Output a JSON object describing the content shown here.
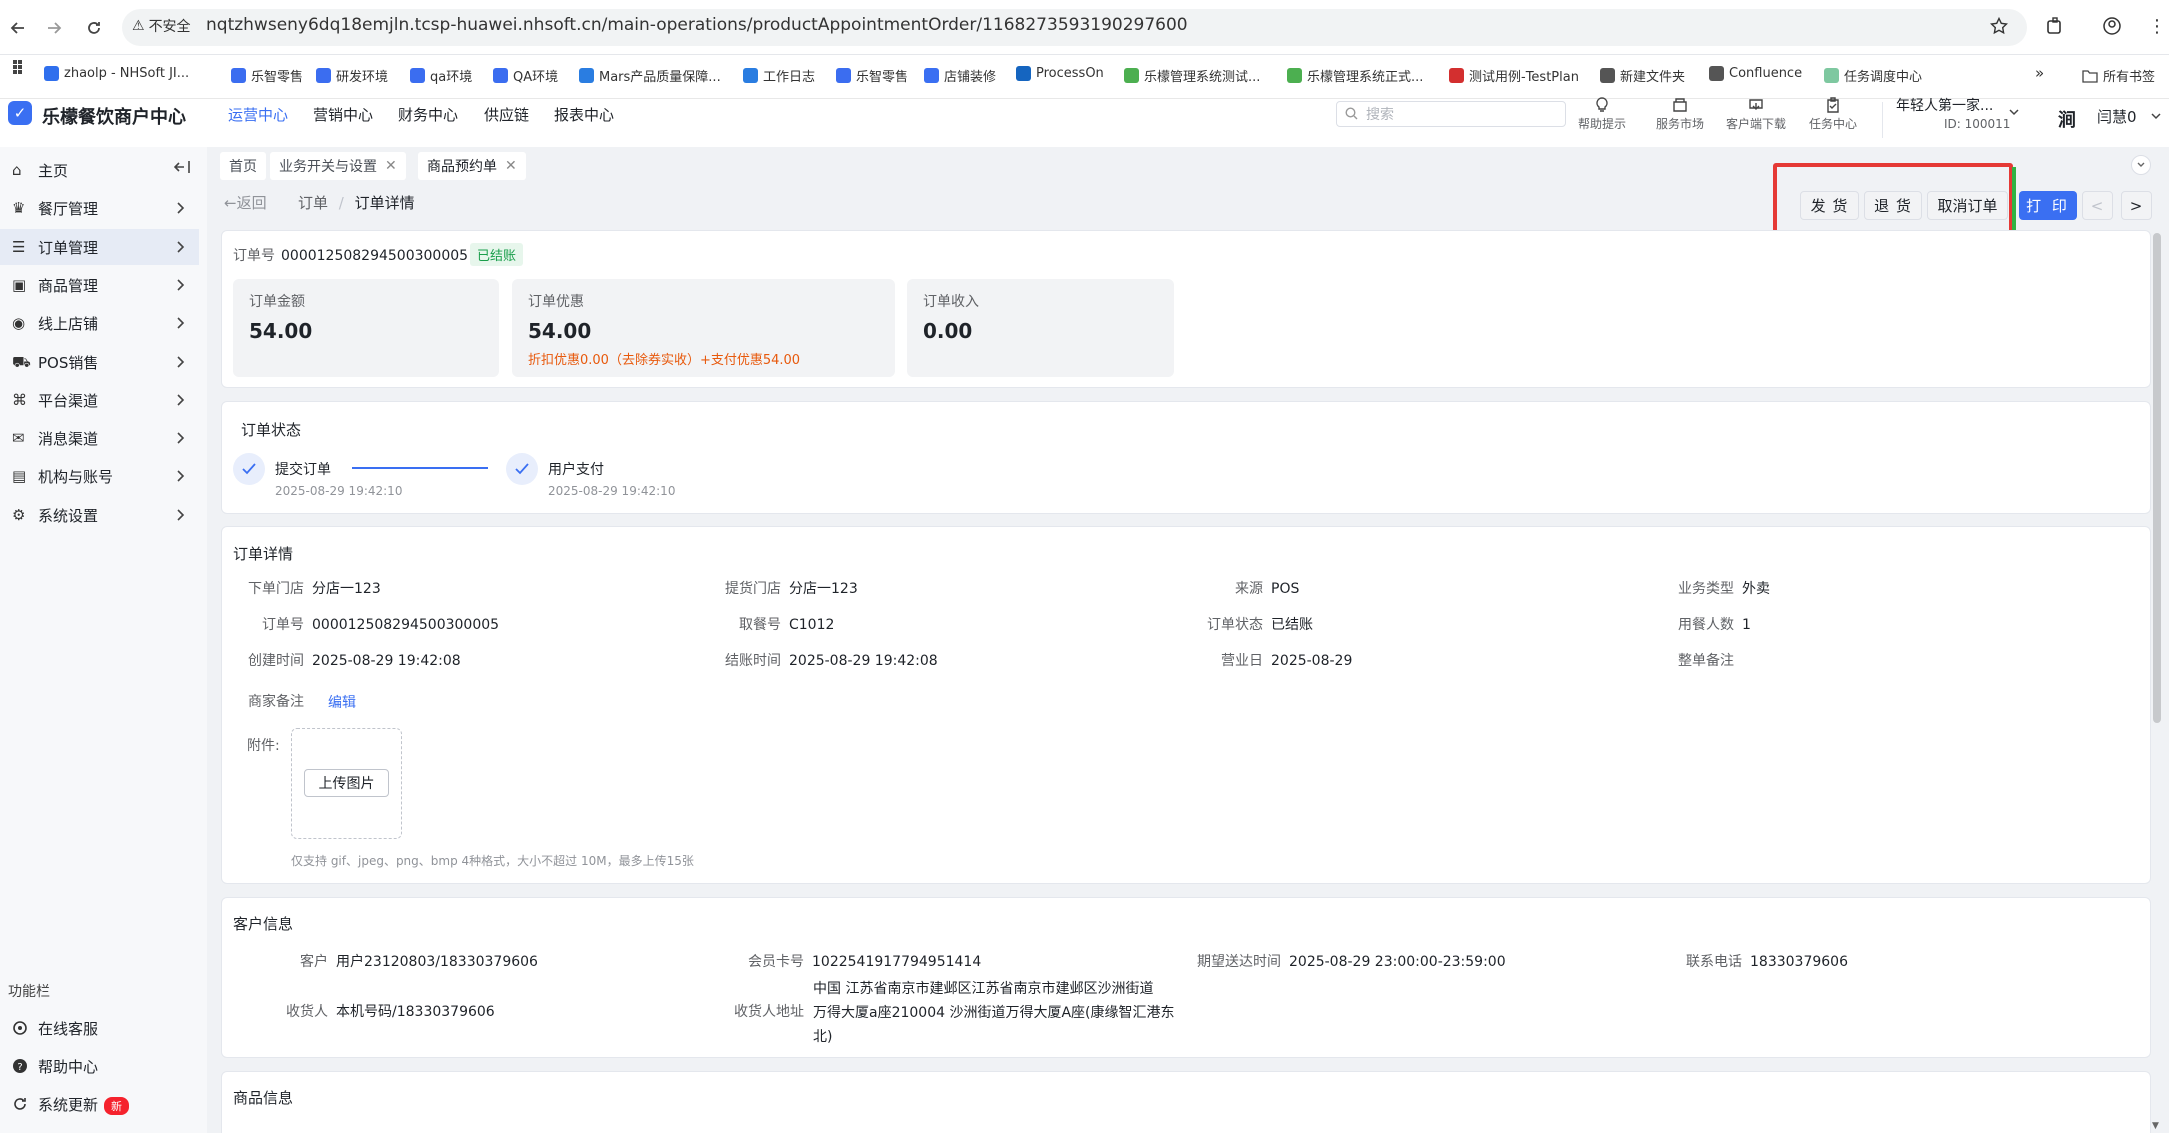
{
  "browser": {
    "security": "不安全",
    "url": "nqtzhwseny6dq18emjln.tcsp-huawei.nhsoft.cn/main-operations/productAppointmentOrder/1168273593190297600",
    "bookmarks": [
      "zhaolp - NHSoft JI...",
      "乐智零售",
      "研发环境",
      "qa环境",
      "QA环境",
      "Mars产品质量保障...",
      "工作日志",
      "乐智零售",
      "店铺装修",
      "ProcessOn",
      "乐檬管理系统测试...",
      "乐檬管理系统正式...",
      "测试用例-TestPlan",
      "新建文件夹",
      "Confluence",
      "任务调度中心"
    ],
    "all_bookmarks": "所有书签",
    "bookmark_colors": [
      "#2f6fed",
      "#3b6df0",
      "#3b6df0",
      "#3b6df0",
      "#3b6df0",
      "#2a7de1",
      "#2a7de1",
      "#3b6df0",
      "#3a6ff2",
      "#1565c0",
      "#4caf50",
      "#4caf50",
      "#d32f2f",
      "#555555",
      "#555555",
      "#7ec8a0"
    ]
  },
  "app": {
    "logo": "✓",
    "title": "乐檬餐饮商户中心",
    "nav": [
      "运营中心",
      "营销中心",
      "财务中心",
      "供应链",
      "报表中心"
    ],
    "search_placeholder": "搜索",
    "header_icons": [
      "帮助提示",
      "服务市场",
      "客户端下载",
      "任务中心"
    ],
    "store_name": "年轻人第一家...",
    "store_id": "ID: 100011",
    "avatar": "涧",
    "user_name": "闫慧0",
    "accent": "#3a6ff2"
  },
  "sidebar": {
    "items": [
      "主页",
      "餐厅管理",
      "订单管理",
      "商品管理",
      "线上店铺",
      "POS销售",
      "平台渠道",
      "消息渠道",
      "机构与账号",
      "系统设置"
    ],
    "func_label": "功能栏",
    "bottom": [
      "在线客服",
      "帮助中心",
      "系统更新"
    ],
    "new_badge": "新"
  },
  "tabs": [
    "首页",
    "业务开关与设置",
    "商品预约单"
  ],
  "back": "返回",
  "breadcrumb": {
    "parent": "订单",
    "current": "订单详情"
  },
  "actions": {
    "ship": "发 货",
    "return": "退 货",
    "cancel": "取消订单",
    "print": "打 印",
    "prev": "<",
    "next": ">"
  },
  "summary": {
    "order_no_label": "订单号",
    "order_no": "000012508294500300005",
    "status": "已结账",
    "amount_label": "订单金额",
    "amount": "54.00",
    "discount_label": "订单优惠",
    "discount": "54.00",
    "discount_detail": "折扣优惠0.00（去除券实收）+支付优惠54.00",
    "income_label": "订单收入",
    "income": "0.00"
  },
  "status_card": {
    "title": "订单状态",
    "steps": [
      {
        "label": "提交订单",
        "time": "2025-08-29 19:42:10"
      },
      {
        "label": "用户支付",
        "time": "2025-08-29 19:42:10"
      }
    ]
  },
  "detail": {
    "title": "订单详情",
    "fields": {
      "order_store": {
        "k": "下单门店",
        "v": "分店一123"
      },
      "pickup_store": {
        "k": "提货门店",
        "v": "分店一123"
      },
      "source": {
        "k": "来源",
        "v": "POS"
      },
      "biz_type": {
        "k": "业务类型",
        "v": "外卖"
      },
      "order_no": {
        "k": "订单号",
        "v": "000012508294500300005"
      },
      "pickup_no": {
        "k": "取餐号",
        "v": "C1012"
      },
      "order_status": {
        "k": "订单状态",
        "v": "已结账"
      },
      "diners": {
        "k": "用餐人数",
        "v": "1"
      },
      "created": {
        "k": "创建时间",
        "v": "2025-08-29 19:42:08"
      },
      "settled": {
        "k": "结账时间",
        "v": "2025-08-29 19:42:08"
      },
      "biz_day": {
        "k": "营业日",
        "v": "2025-08-29"
      },
      "note": {
        "k": "整单备注",
        "v": ""
      },
      "merchant_note": {
        "k": "商家备注",
        "v": ""
      }
    },
    "edit": "编辑",
    "attach_label": "附件:",
    "upload_btn": "上传图片",
    "upload_hint": "仅支持 gif、jpeg、png、bmp 4种格式，大小不超过 10M，最多上传15张"
  },
  "customer": {
    "title": "客户信息",
    "customer": {
      "k": "客户",
      "v": "用户23120803/18330379606"
    },
    "card_no": {
      "k": "会员卡号",
      "v": "1022541917794951414"
    },
    "expected": {
      "k": "期望送达时间",
      "v": "2025-08-29 23:00:00-23:59:00"
    },
    "phone": {
      "k": "联系电话",
      "v": "18330379606"
    },
    "receiver": {
      "k": "收货人",
      "v": "本机号码/18330379606"
    },
    "address_label": "收货人地址",
    "address_lines": [
      "中国 江苏省南京市建邺区江苏省南京市建邺区沙洲街道",
      "万得大厦a座210004 沙洲街道万得大厦A座(康缘智汇港东",
      "北)"
    ]
  },
  "goods": {
    "title": "商品信息"
  }
}
